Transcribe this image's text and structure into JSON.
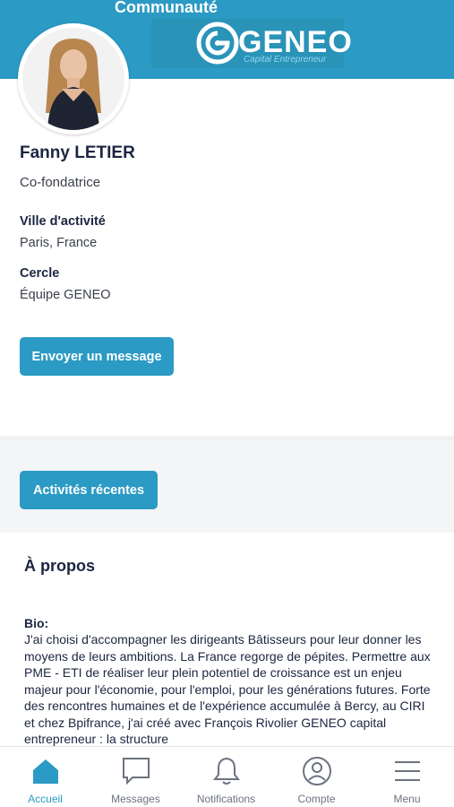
{
  "header": {
    "title": "Communauté",
    "brand_name": "GENEO",
    "brand_tagline": "Capital Entrepreneur"
  },
  "profile": {
    "name": "Fanny LETIER",
    "role": "Co-fondatrice",
    "city_label": "Ville d'activité",
    "city_value": "Paris, France",
    "circle_label": "Cercle",
    "circle_value": "Équipe GENEO",
    "message_button": "Envoyer un message"
  },
  "activities_button": "Activités récentes",
  "about": {
    "title": "À propos",
    "bio_label": "Bio:",
    "bio_text": "J'ai choisi d'accompagner les dirigeants Bâtisseurs pour leur donner les moyens de leurs ambitions. La France regorge de pépites. Permettre aux PME - ETI de réaliser leur plein potentiel de croissance est un enjeu majeur pour l'économie, pour l'emploi, pour les générations futures. Forte des rencontres humaines et de l'expérience accumulée à Bercy, au CIRI et chez Bpifrance, j'ai créé avec François Rivolier GENEO capital entrepreneur : la structure"
  },
  "tabbar": {
    "items": [
      {
        "label": "Accueil",
        "icon": "home-icon",
        "active": true
      },
      {
        "label": "Messages",
        "icon": "chat-icon",
        "active": false
      },
      {
        "label": "Notifications",
        "icon": "bell-icon",
        "active": false
      },
      {
        "label": "Compte",
        "icon": "user-circle-icon",
        "active": false
      },
      {
        "label": "Menu",
        "icon": "hamburger-icon",
        "active": false
      }
    ]
  },
  "colors": {
    "primary": "#2b9ac4",
    "text_dark": "#1c2541",
    "text_muted": "#6c7280"
  }
}
